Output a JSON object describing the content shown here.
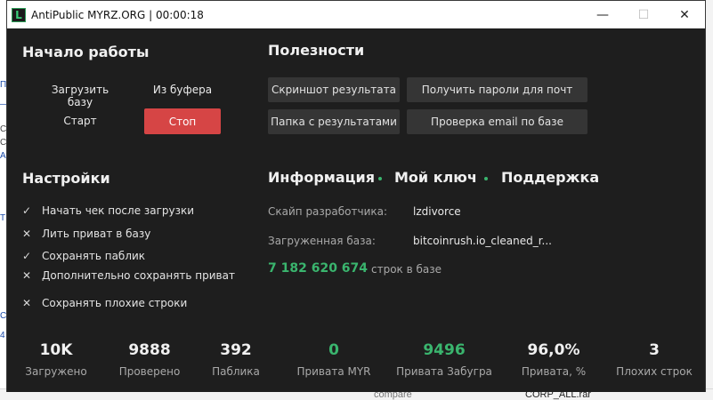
{
  "window": {
    "title": "AntiPublic MYRZ.ORG | 00:00:18",
    "icon_letter": "L"
  },
  "start": {
    "title": "Начало работы",
    "load_base": "Загрузить базу",
    "from_clipboard": "Из буфера",
    "start": "Старт",
    "stop": "Стоп"
  },
  "utils": {
    "title": "Полезности",
    "screenshot": "Скриншот результата",
    "get_passwords": "Получить пароли для почт",
    "results_folder": "Папка с результатами",
    "check_email": "Проверка email по базе"
  },
  "settings": {
    "title": "Настройки",
    "items": [
      {
        "label": "Начать чек после загрузки",
        "checked": true
      },
      {
        "label": "Лить приват в базу",
        "checked": false
      },
      {
        "label": "Сохранять паблик",
        "checked": true
      },
      {
        "label": "Дополнительно сохранять приват",
        "checked": false
      },
      {
        "label": "Сохранять плохие строки",
        "checked": false
      }
    ]
  },
  "info": {
    "tab_info": "Информация",
    "tab_key": "Мой ключ",
    "tab_support": "Поддержка",
    "skype_label": "Скайп разработчика:",
    "skype_value": "lzdivorce",
    "base_label": "Загруженная база:",
    "base_value": "bitcoinrush.io_cleaned_r...",
    "rows_count": "7 182 620 674",
    "rows_label": "строк в базе"
  },
  "stats": [
    {
      "value": "10K",
      "label": "Загружено",
      "green": false
    },
    {
      "value": "9888",
      "label": "Проверено",
      "green": false
    },
    {
      "value": "392",
      "label": "Паблика",
      "green": false
    },
    {
      "value": "0",
      "label": "Привата MYR",
      "green": true
    },
    {
      "value": "9496",
      "label": "Привата Забугра",
      "green": true
    },
    {
      "value": "96,0%",
      "label": "Привата, %",
      "green": false
    },
    {
      "value": "3",
      "label": "Плохих строк",
      "green": false
    }
  ],
  "colors": {
    "accent_green": "#3ab56e",
    "stop_red": "#d64545",
    "background": "#1e1e1e"
  },
  "icons": {
    "checked": "✓",
    "unchecked": "✕",
    "minimize": "—",
    "maximize": "☐",
    "close": "✕"
  }
}
